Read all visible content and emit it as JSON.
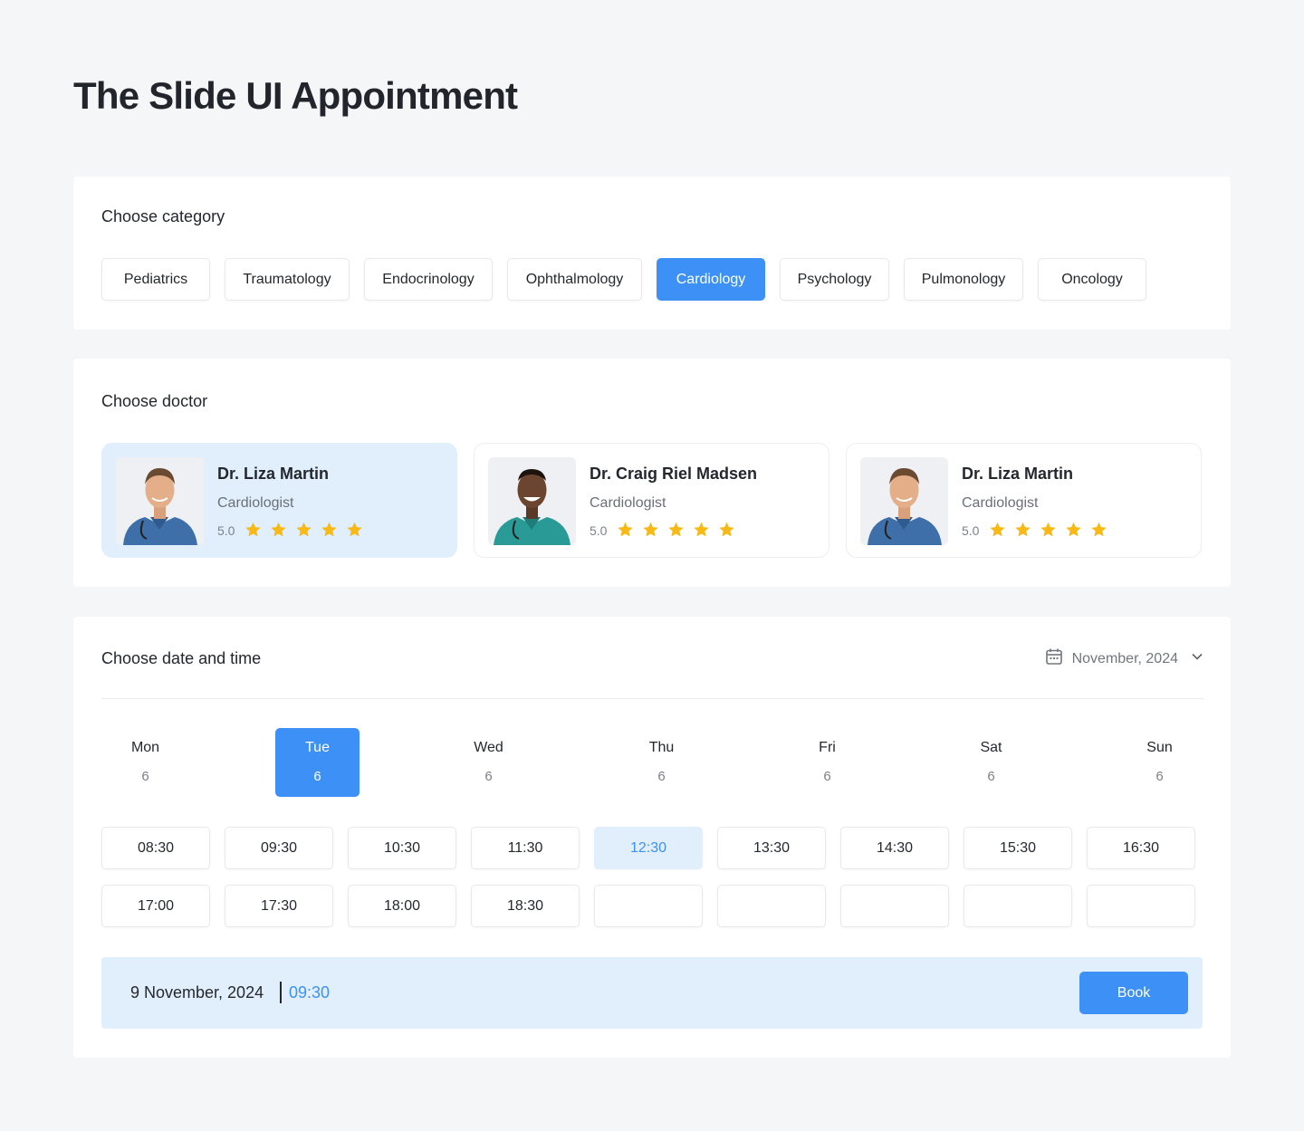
{
  "page": {
    "title": "The Slide UI Appointment"
  },
  "category": {
    "title": "Choose category",
    "items": [
      "Pediatrics",
      "Traumatology",
      "Endocrinology",
      "Ophthalmology",
      "Cardiology",
      "Psychology",
      "Pulmonology",
      "Oncology"
    ],
    "selected": "Cardiology"
  },
  "doctor": {
    "title": "Choose doctor",
    "items": [
      {
        "name": "Dr. Liza Martin",
        "specialty": "Cardiologist",
        "rating": "5.0",
        "stars": 5,
        "selected": true
      },
      {
        "name": "Dr. Craig Riel Madsen",
        "specialty": "Cardiologist",
        "rating": "5.0",
        "stars": 5,
        "selected": false
      },
      {
        "name": "Dr. Liza Martin",
        "specialty": "Cardiologist",
        "rating": "5.0",
        "stars": 5,
        "selected": false
      }
    ]
  },
  "datetime": {
    "title": "Choose date and time",
    "month_label": "November, 2024",
    "days": [
      {
        "name": "Mon",
        "num": "6"
      },
      {
        "name": "Tue",
        "num": "6"
      },
      {
        "name": "Wed",
        "num": "6"
      },
      {
        "name": "Thu",
        "num": "6"
      },
      {
        "name": "Fri",
        "num": "6"
      },
      {
        "name": "Sat",
        "num": "6"
      },
      {
        "name": "Sun",
        "num": "6"
      }
    ],
    "selected_day": "Tue",
    "slots_row1": [
      "08:30",
      "09:30",
      "10:30",
      "11:30",
      "12:30",
      "13:30",
      "14:30",
      "15:30",
      "16:30"
    ],
    "slots_row2": [
      "17:00",
      "17:30",
      "18:00",
      "18:30",
      "",
      "",
      "",
      "",
      ""
    ],
    "selected_slot": "12:30"
  },
  "summary": {
    "date": "9 November, 2024",
    "time": "09:30",
    "book_label": "Book"
  },
  "colors": {
    "accent": "#3d90f5",
    "accent_light": "#e1effd",
    "star": "#f7b916"
  }
}
